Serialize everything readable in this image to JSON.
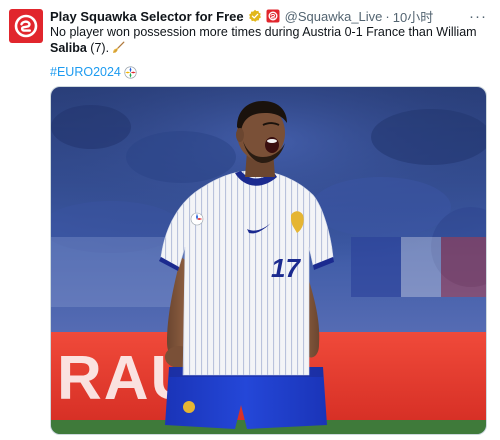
{
  "tweet": {
    "display_name": "Play Squawka Selector for Free",
    "handle": "@Squawka_Live",
    "separator": "·",
    "time": "10小时",
    "more_label": "···",
    "text_part1": "No player won possession more times during Austria 0-1 France than William ",
    "text_bold": "Saliba",
    "text_part2": " (7).",
    "hashtag": "#EURO2024"
  },
  "media": {
    "player_number": "17",
    "board_text": "RAUS"
  },
  "colors": {
    "brand_red": "#e1262d",
    "link_blue": "#1d9bf0",
    "verified_gold": "#e2b719",
    "kit_white": "#f4f5f7",
    "kit_navy": "#1b2a8f",
    "shorts_blue": "#1f3fd1"
  },
  "icons": {
    "avatar": "squawka-logo-icon",
    "verified": "verified-badge-icon",
    "affiliate": "affiliate-badge-icon",
    "broom": "broom-emoji-icon",
    "euro": "euro-trophy-emoji-icon",
    "more": "more-options-icon"
  }
}
